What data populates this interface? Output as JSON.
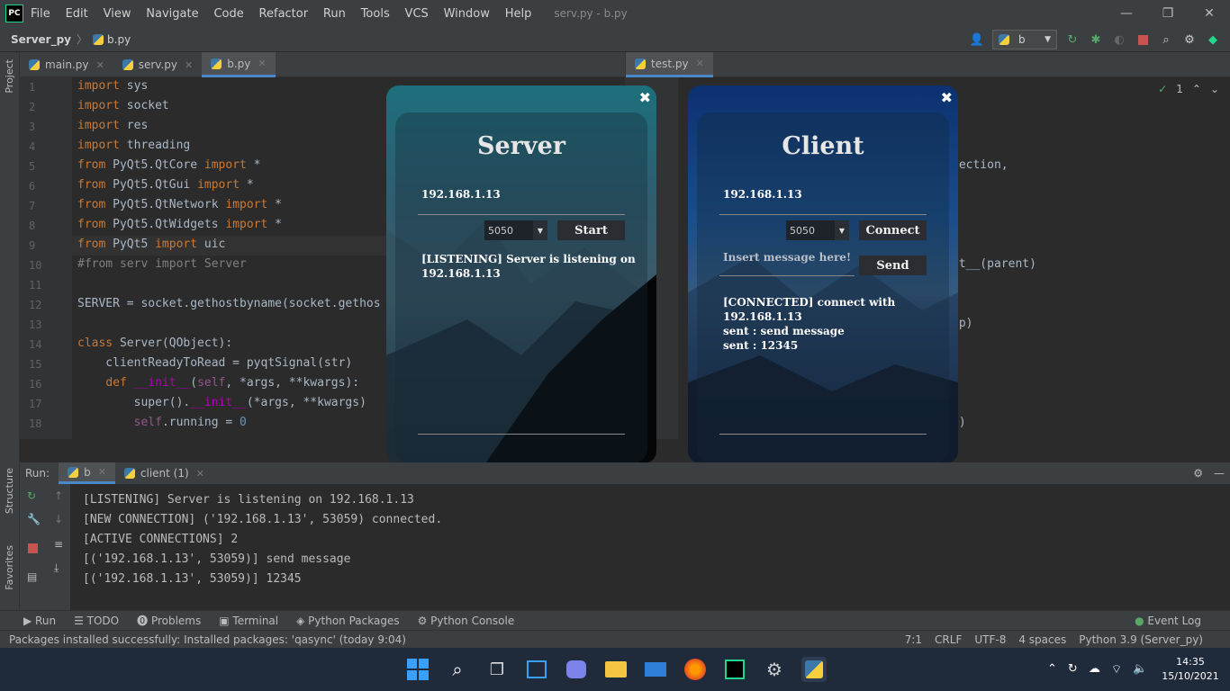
{
  "titlebar": {
    "logo": "PC",
    "menu": [
      "File",
      "Edit",
      "View",
      "Navigate",
      "Code",
      "Refactor",
      "Run",
      "Tools",
      "VCS",
      "Window",
      "Help"
    ],
    "window_title": "serv.py - b.py",
    "controls": [
      "—",
      "❐",
      "✕"
    ]
  },
  "navbar": {
    "project": "Server_py",
    "file": "b.py",
    "run_config": "b"
  },
  "left_strip": {
    "project": "Project",
    "structure": "Structure",
    "favorites": "Favorites"
  },
  "tabs_left": [
    {
      "label": "main.py"
    },
    {
      "label": "serv.py"
    },
    {
      "label": "b.py"
    }
  ],
  "tabs_right": [
    {
      "label": "test.py"
    }
  ],
  "inspections": "1",
  "code_lines": [
    "import sys",
    "import socket",
    "import res",
    "import threading",
    "from PyQt5.QtCore import *",
    "from PyQt5.QtGui import *",
    "from PyQt5.QtNetwork import *",
    "from PyQt5.QtWidgets import *",
    "from PyQt5 import uic",
    "#from serv import Server",
    "",
    "SERVER = socket.gethostbyname(socket.gethos",
    "",
    "class Server(QObject):",
    "    clientReadyToRead = pyqtSignal(str)",
    "    def __init__(self, *args, **kwargs):",
    "        super().__init__(*args, **kwargs)",
    "        self.running = 0"
  ],
  "right_code_fragments": [
    "nection,",
    "it__(parent)",
    "ap)",
    "d)"
  ],
  "run": {
    "label": "Run:",
    "tabs": [
      "b",
      "client (1)"
    ],
    "console": [
      "[LISTENING] Server is listening on 192.168.1.13",
      "[NEW CONNECTION] ('192.168.1.13', 53059) connected.",
      "[ACTIVE CONNECTIONS] 2",
      "[('192.168.1.13', 53059)] send message",
      "[('192.168.1.13', 53059)] 12345"
    ]
  },
  "bottom_tools": [
    "Run",
    "TODO",
    "Problems",
    "Terminal",
    "Python Packages",
    "Python Console"
  ],
  "event_log": "Event Log",
  "status": {
    "message": "Packages installed successfully: Installed packages: 'qasync' (today 9:04)",
    "position": "7:1",
    "line_sep": "CRLF",
    "encoding": "UTF-8",
    "indent": "4 spaces",
    "interpreter": "Python 3.9 (Server_py)"
  },
  "server_dialog": {
    "title": "Server",
    "ip": "192.168.1.13",
    "port": "5050",
    "button": "Start",
    "log": [
      "[LISTENING] Server is listening on",
      "192.168.1.13"
    ]
  },
  "client_dialog": {
    "title": "Client",
    "ip": "192.168.1.13",
    "port": "5050",
    "connect_button": "Connect",
    "message_placeholder": "Insert message here!",
    "send_button": "Send",
    "log": [
      "[CONNECTED] connect with",
      "192.168.1.13",
      "sent : send message",
      "sent : 12345"
    ]
  },
  "taskbar": {
    "time": "14:35",
    "date": "15/10/2021"
  },
  "colors": {
    "accent": "#4a88c7",
    "ide_bg": "#2b2b2b",
    "panel_bg": "#3c3f41",
    "keyword": "#cc7832"
  }
}
